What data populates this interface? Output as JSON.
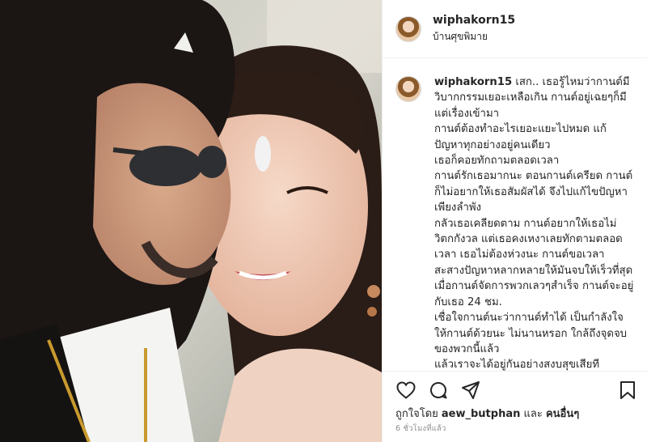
{
  "post": {
    "username": "wiphakorn15",
    "location": "บ้านศุขพิมาย",
    "caption_user": "wiphakorn15",
    "caption_lines": [
      "เสก.. เธอรู้ไหมว่ากานต์มีวิบากกรรมเยอะเหลือเกิน กานต์อยู่เฉยๆก็มีแต่เรื่องเข้ามา",
      "กานต์ต้องทำอะไรเยอะแยะไปหมด แก้ปัญหาทุกอย่างอยู่คนเดียว",
      "เธอก็คอยทักถามตลอดเวลา",
      "กานต์รักเธอมากนะ ตอนกานต์เครียด กานต์ก็ไม่อยากให้เธอสัมผัสได้ จึงไปแก้ไขปัญหาเพียงลำพัง",
      "กลัวเธอเคลียดตาม กานต์อยากให้เธอไม่วิตกกังวล แต่เธอคงเหงาเลยทักตามตลอดเวลา เธอไม่ต้องห่วงนะ กานต์ขอเวลาสะสางปัญหาหลากหลายให้มันจบให้เร็วที่สุด",
      "เมื่อกานต์จัดการพวกเลวๆสำเร็จ กานต์จะอยู่กับเธอ 24 ชม.",
      "เชื่อใจกานต์นะว่ากานต์ทำได้ เป็นกำลังใจให้กานต์ด้วยนะ ไม่นานหรอก ใกล้ถึงจุดจบของพวกนี้แล้ว",
      "แล้วเราจะได้อยู่กันอย่างสงบสุขเสียที"
    ],
    "likes_prefix": "ถูกใจโดย",
    "likes_user": "aew_butphan",
    "likes_and": "และ",
    "likes_others": "คนอื่นๆ",
    "time_ago": "6 ชั่วโมงที่แล้ว",
    "icons": {
      "like": "heart-icon",
      "comment": "comment-icon",
      "share": "share-icon",
      "save": "bookmark-icon"
    }
  }
}
